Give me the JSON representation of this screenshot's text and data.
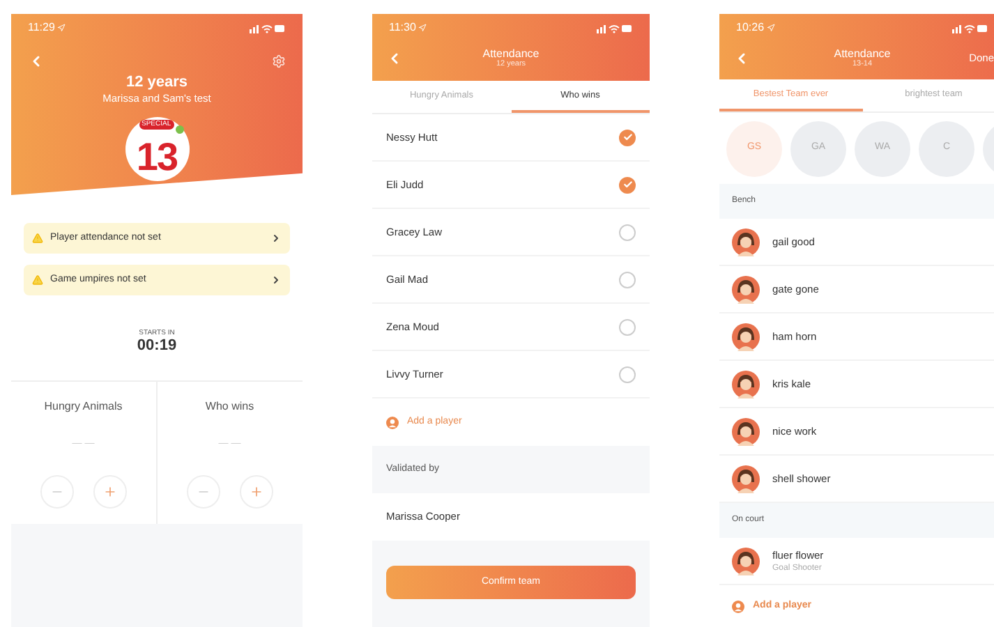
{
  "match_screen": {
    "status_time": "11:29",
    "title": "12 years",
    "subtitle": "Marissa and Sam's test",
    "logo": {
      "number": "13",
      "badge": "SPECIAL"
    },
    "alerts": [
      {
        "text": "Player attendance not set"
      },
      {
        "text": "Game umpires not set"
      }
    ],
    "countdown": {
      "label": "STARTS IN",
      "time": "00:19"
    },
    "teams": [
      {
        "name": "Hungry Animals",
        "score": "— —"
      },
      {
        "name": "Who wins",
        "score": "— —"
      }
    ]
  },
  "attendance_screen": {
    "status_time": "11:30",
    "title": "Attendance",
    "subtitle": "12 years",
    "tabs": [
      {
        "label": "Hungry Animals",
        "selected": false
      },
      {
        "label": "Who wins",
        "selected": true
      }
    ],
    "players": [
      {
        "name": "Nessy Hutt",
        "checked": true
      },
      {
        "name": "Eli Judd",
        "checked": true
      },
      {
        "name": "Gracey Law",
        "checked": false
      },
      {
        "name": "Gail Mad",
        "checked": false
      },
      {
        "name": "Zena Moud",
        "checked": false
      },
      {
        "name": "Livvy Turner",
        "checked": false
      }
    ],
    "add_player": "Add a player",
    "validated_label": "Validated by",
    "validator": "Marissa Cooper",
    "confirm_button": "Confirm team"
  },
  "positions_screen": {
    "status_time": "10:26",
    "title": "Attendance",
    "subtitle": "13-14",
    "done": "Done",
    "tabs": [
      {
        "label": "Bestest Team ever",
        "selected": true
      },
      {
        "label": "brightest team",
        "selected": false
      }
    ],
    "positions": [
      {
        "label": "GS",
        "selected": true
      },
      {
        "label": "GA",
        "selected": false
      },
      {
        "label": "WA",
        "selected": false
      },
      {
        "label": "C",
        "selected": false
      },
      {
        "selected": false
      }
    ],
    "sections": [
      {
        "title": "Bench",
        "players": [
          {
            "name": "gail good"
          },
          {
            "name": "gate gone"
          },
          {
            "name": "ham horn"
          },
          {
            "name": "kris kale"
          },
          {
            "name": "nice work"
          },
          {
            "name": "shell shower"
          }
        ]
      },
      {
        "title": "On court",
        "players": [
          {
            "name": "fluer flower",
            "position": "Goal Shooter"
          }
        ]
      }
    ],
    "add_player": "Add a player"
  }
}
